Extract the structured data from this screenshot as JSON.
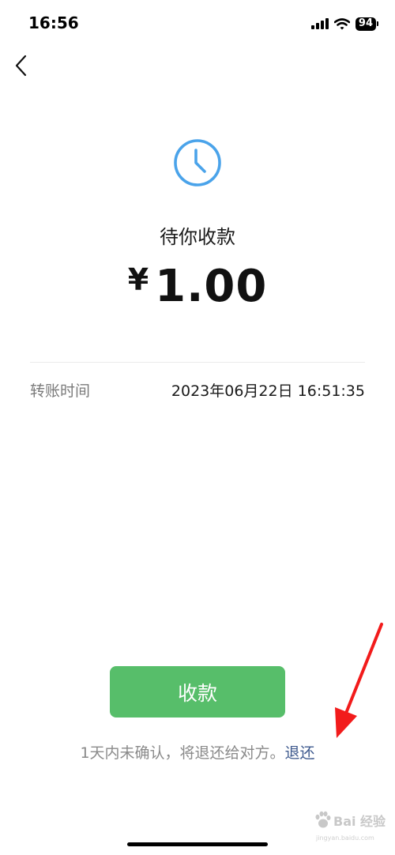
{
  "status_bar": {
    "time": "16:56",
    "battery": "94"
  },
  "transfer": {
    "status": "待你收款",
    "currency_symbol": "¥",
    "amount": "1.00",
    "time_label": "转账时间",
    "time_value": "2023年06月22日 16:51:35"
  },
  "actions": {
    "receive_label": "收款",
    "notice_text": "1天内未确认，将退还给对方。",
    "refund_label": "退还"
  },
  "watermark": {
    "text": "Bai 经验",
    "sub": "jingyan.baidu.com"
  },
  "colors": {
    "accent_green": "#57be6a",
    "link_blue": "#3f5a8e",
    "clock_blue": "#4aa3ea",
    "annotation_red": "#f21b1b"
  }
}
